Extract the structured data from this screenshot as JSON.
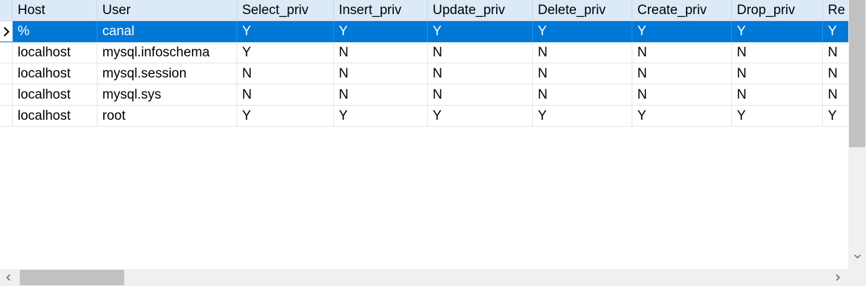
{
  "columns": [
    "Host",
    "User",
    "Select_priv",
    "Insert_priv",
    "Update_priv",
    "Delete_priv",
    "Create_priv",
    "Drop_priv",
    "Re"
  ],
  "rows": [
    {
      "cells": [
        "%",
        "canal",
        "Y",
        "Y",
        "Y",
        "Y",
        "Y",
        "Y",
        "Y"
      ]
    },
    {
      "cells": [
        "localhost",
        "mysql.infoschema",
        "Y",
        "N",
        "N",
        "N",
        "N",
        "N",
        "N"
      ]
    },
    {
      "cells": [
        "localhost",
        "mysql.session",
        "N",
        "N",
        "N",
        "N",
        "N",
        "N",
        "N"
      ]
    },
    {
      "cells": [
        "localhost",
        "mysql.sys",
        "N",
        "N",
        "N",
        "N",
        "N",
        "N",
        "N"
      ]
    },
    {
      "cells": [
        "localhost",
        "root",
        "Y",
        "Y",
        "Y",
        "Y",
        "Y",
        "Y",
        "Y"
      ]
    }
  ],
  "selected_row": 0,
  "colors": {
    "header_bg": "#dce9f7",
    "selection": "#0078d7",
    "scrollbar_track": "#f0f0f0",
    "scrollbar_thumb": "#c1c1c1"
  },
  "icons": {
    "row_indicator": "current-row-arrow-icon",
    "scroll_down": "chevron-down-icon",
    "scroll_left": "chevron-left-icon",
    "scroll_right": "chevron-right-icon"
  }
}
